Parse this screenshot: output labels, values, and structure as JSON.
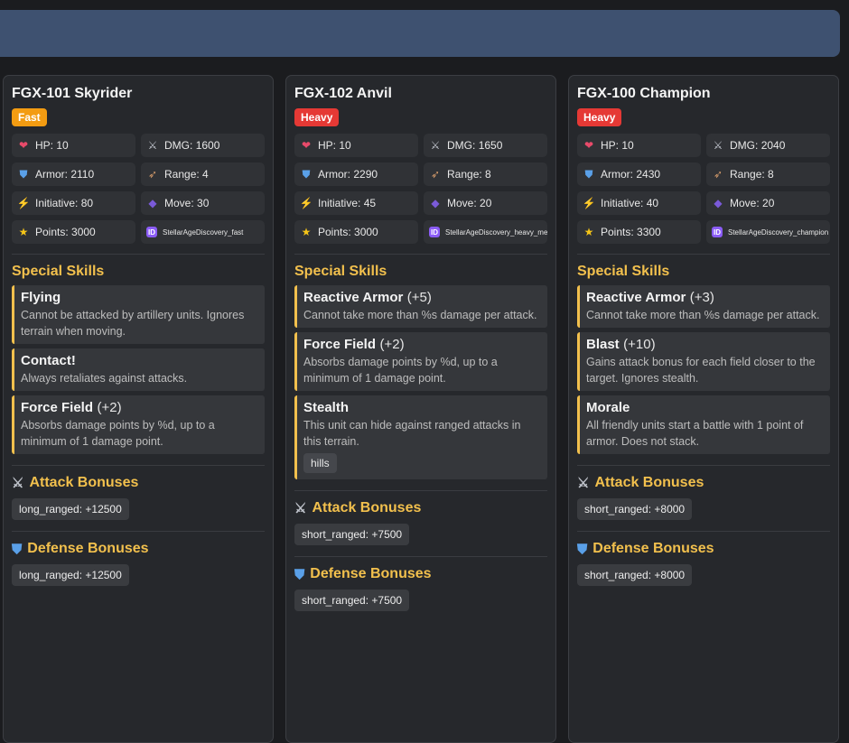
{
  "colors": {
    "accent": "#f2c04d",
    "fast": "#f39c12",
    "heavy": "#e53935",
    "header_bar": "#3e5170"
  },
  "labels": {
    "hp": "HP:",
    "dmg": "DMG:",
    "armor": "Armor:",
    "range": "Range:",
    "initiative": "Initiative:",
    "move": "Move:",
    "points": "Points:",
    "special_skills": "Special Skills",
    "attack_bonuses": "Attack Bonuses",
    "defense_bonuses": "Defense Bonuses"
  },
  "units": [
    {
      "name": "FGX-101 Skyrider",
      "badge": "Fast",
      "badge_type": "fast",
      "hp": "10",
      "dmg": "1600",
      "armor": "2110",
      "range": "4",
      "initiative": "80",
      "move": "30",
      "points": "3000",
      "id": "StellarAgeDiscovery_fast",
      "skills": [
        {
          "name": "Flying",
          "level": "",
          "desc": "Cannot be attacked by artillery units. Ignores terrain when moving.",
          "tags": []
        },
        {
          "name": "Contact!",
          "level": "",
          "desc": "Always retaliates against attacks.",
          "tags": []
        },
        {
          "name": "Force Field",
          "level": "(+2)",
          "desc": "Absorbs damage points by %d, up to a minimum of 1 damage point.",
          "tags": []
        }
      ],
      "attack_bonuses": [
        "long_ranged: +12500"
      ],
      "defense_bonuses": [
        "long_ranged: +12500"
      ]
    },
    {
      "name": "FGX-102 Anvil",
      "badge": "Heavy",
      "badge_type": "heavy",
      "hp": "10",
      "dmg": "1650",
      "armor": "2290",
      "range": "8",
      "initiative": "45",
      "move": "20",
      "points": "3000",
      "id": "StellarAgeDiscovery_heavy_melee",
      "skills": [
        {
          "name": "Reactive Armor",
          "level": "(+5)",
          "desc": "Cannot take more than %s damage per attack.",
          "tags": []
        },
        {
          "name": "Force Field",
          "level": "(+2)",
          "desc": "Absorbs damage points by %d, up to a minimum of 1 damage point.",
          "tags": []
        },
        {
          "name": "Stealth",
          "level": "",
          "desc": "This unit can hide against ranged attacks in this terrain.",
          "tags": [
            "hills"
          ]
        }
      ],
      "attack_bonuses": [
        "short_ranged: +7500"
      ],
      "defense_bonuses": [
        "short_ranged: +7500"
      ]
    },
    {
      "name": "FGX-100 Champion",
      "badge": "Heavy",
      "badge_type": "heavy",
      "hp": "10",
      "dmg": "2040",
      "armor": "2430",
      "range": "8",
      "initiative": "40",
      "move": "20",
      "points": "3300",
      "id": "StellarAgeDiscovery_champion",
      "skills": [
        {
          "name": "Reactive Armor",
          "level": "(+3)",
          "desc": "Cannot take more than %s damage per attack.",
          "tags": []
        },
        {
          "name": "Blast",
          "level": "(+10)",
          "desc": "Gains attack bonus for each field closer to the target. Ignores stealth.",
          "tags": []
        },
        {
          "name": "Morale",
          "level": "",
          "desc": "All friendly units start a battle with 1 point of armor. Does not stack.",
          "tags": []
        }
      ],
      "attack_bonuses": [
        "short_ranged: +8000"
      ],
      "defense_bonuses": [
        "short_ranged: +8000"
      ]
    }
  ]
}
